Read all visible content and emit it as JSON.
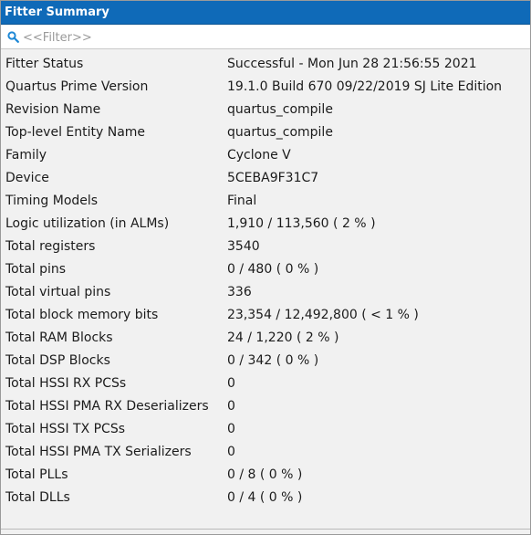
{
  "panel": {
    "title": "Fitter Summary",
    "filter": {
      "placeholder": "<<Filter>>",
      "value": ""
    },
    "accent_color": "#0f6ab8"
  },
  "rows": [
    {
      "label": "Fitter Status",
      "value": "Successful - Mon Jun 28 21:56:55 2021"
    },
    {
      "label": "Quartus Prime Version",
      "value": "19.1.0 Build 670 09/22/2019 SJ Lite Edition"
    },
    {
      "label": "Revision Name",
      "value": "quartus_compile"
    },
    {
      "label": "Top-level Entity Name",
      "value": "quartus_compile"
    },
    {
      "label": "Family",
      "value": "Cyclone V"
    },
    {
      "label": "Device",
      "value": "5CEBA9F31C7"
    },
    {
      "label": "Timing Models",
      "value": "Final"
    },
    {
      "label": "Logic utilization (in ALMs)",
      "value": "1,910 / 113,560 ( 2 % )"
    },
    {
      "label": "Total registers",
      "value": "3540"
    },
    {
      "label": "Total pins",
      "value": "0 / 480 ( 0 % )"
    },
    {
      "label": "Total virtual pins",
      "value": "336"
    },
    {
      "label": "Total block memory bits",
      "value": "23,354 / 12,492,800 ( < 1 % )"
    },
    {
      "label": "Total RAM Blocks",
      "value": "24 / 1,220 ( 2 % )"
    },
    {
      "label": "Total DSP Blocks",
      "value": "0 / 342 ( 0 % )"
    },
    {
      "label": "Total HSSI RX PCSs",
      "value": "0"
    },
    {
      "label": "Total HSSI PMA RX Deserializers",
      "value": "0"
    },
    {
      "label": "Total HSSI TX PCSs",
      "value": "0"
    },
    {
      "label": "Total HSSI PMA TX Serializers",
      "value": "0"
    },
    {
      "label": "Total PLLs",
      "value": "0 / 8 ( 0 % )"
    },
    {
      "label": "Total DLLs",
      "value": "0 / 4 ( 0 % )"
    }
  ]
}
